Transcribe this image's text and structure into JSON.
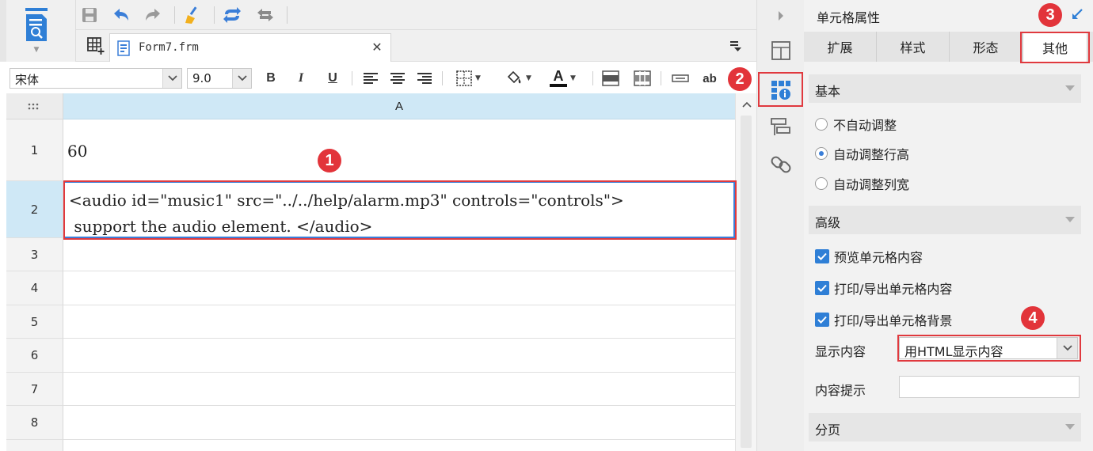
{
  "document_tab": {
    "label": "Form7.frm"
  },
  "format": {
    "font_name": "宋体",
    "font_size": "9.0",
    "bold_label": "B",
    "italic_label": "I",
    "underline_label": "U",
    "text_color_label": "A",
    "ab_label": "ab"
  },
  "grid": {
    "column_header": "A",
    "rows": [
      {
        "num": "1",
        "text": "60"
      },
      {
        "num": "2",
        "text": "<audio id=\"music1\" src=\"../../help/alarm.mp3\" controls=\"controls\">\n support the audio element. </audio>"
      },
      {
        "num": "3",
        "text": ""
      },
      {
        "num": "4",
        "text": ""
      },
      {
        "num": "5",
        "text": ""
      },
      {
        "num": "6",
        "text": ""
      },
      {
        "num": "7",
        "text": ""
      },
      {
        "num": "8",
        "text": ""
      }
    ]
  },
  "properties": {
    "title": "单元格属性",
    "tabs": [
      "扩展",
      "样式",
      "形态",
      "其他"
    ],
    "active_tab": "其他",
    "sections": {
      "basic": "基本",
      "advanced": "高级",
      "paging": "分页"
    },
    "basic_options": [
      "不自动调整",
      "自动调整行高",
      "自动调整列宽"
    ],
    "basic_selected": "自动调整行高",
    "advanced_checks": [
      "预览单元格内容",
      "打印/导出单元格内容",
      "打印/导出单元格背景"
    ],
    "display_content_label": "显示内容",
    "display_content_value": "用HTML显示内容",
    "content_tip_label": "内容提示",
    "content_tip_value": ""
  },
  "annotations": {
    "badge1": "1",
    "badge2": "2",
    "badge3": "3",
    "badge4": "4"
  },
  "colors": {
    "accent_blue": "#2f7fd6",
    "highlight_red": "#e2343a",
    "column_header_bg": "#cfe8f6"
  }
}
